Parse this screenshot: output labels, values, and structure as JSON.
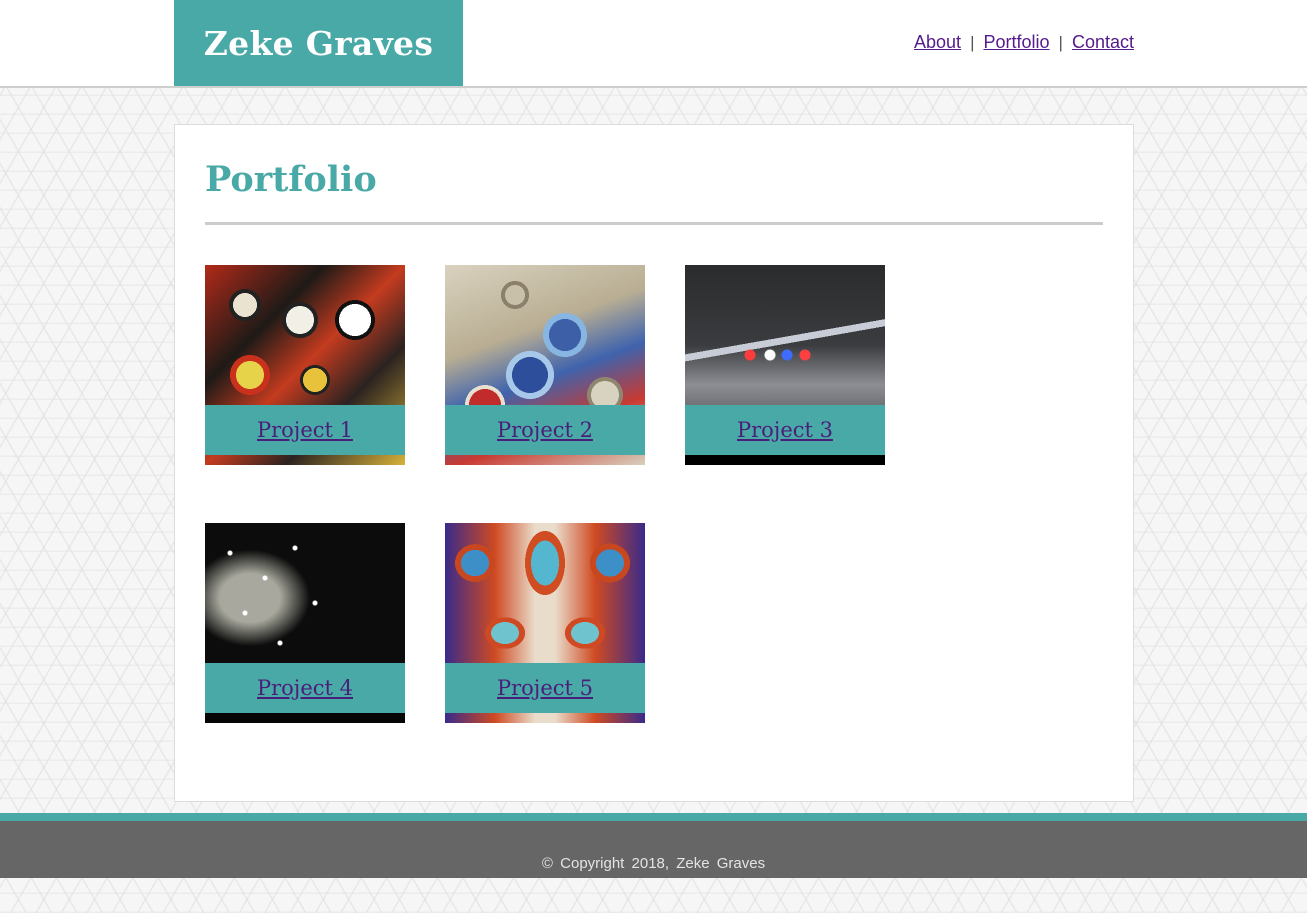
{
  "header": {
    "logo_text": "Zeke Graves",
    "nav": [
      {
        "label": "About"
      },
      {
        "label": "Portfolio"
      },
      {
        "label": "Contact"
      }
    ],
    "separator": "|"
  },
  "main": {
    "title": "Portfolio",
    "projects": [
      {
        "label": "Project 1"
      },
      {
        "label": "Project 2"
      },
      {
        "label": "Project 3"
      },
      {
        "label": "Project 4"
      },
      {
        "label": "Project 5"
      }
    ]
  },
  "footer": {
    "copyright": "© Copyright 2018, Zeke Graves"
  },
  "colors": {
    "accent": "#48a9a6",
    "footer_bg": "#666666",
    "link": "#551a8b"
  }
}
